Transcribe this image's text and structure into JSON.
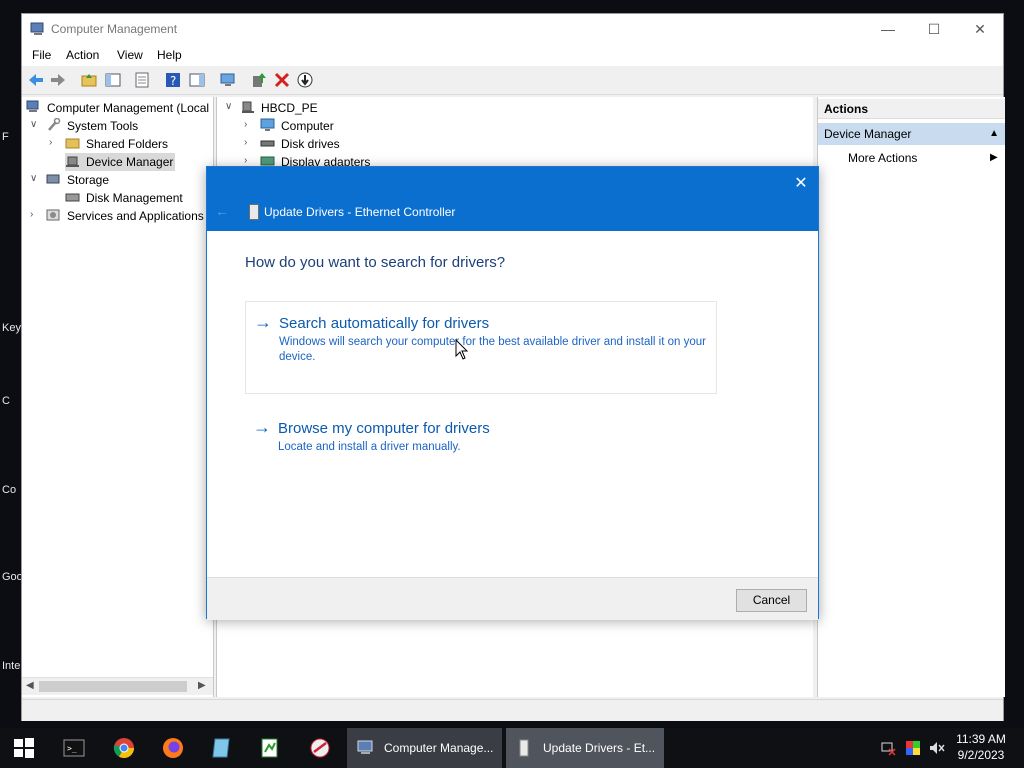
{
  "desktop": {
    "fragments": [
      "F",
      "Key",
      "C",
      "Co",
      "Goo",
      "Inte"
    ]
  },
  "window": {
    "title": "Computer Management",
    "controls": {
      "minimize": "—",
      "maximize": "☐",
      "close": "✕"
    },
    "menu": [
      "File",
      "Action",
      "View",
      "Help"
    ]
  },
  "tree": {
    "root": "Computer Management (Local",
    "system_tools": "System Tools",
    "shared_folders": "Shared Folders",
    "device_manager": "Device Manager",
    "storage": "Storage",
    "disk_management": "Disk Management",
    "services": "Services and Applications"
  },
  "devices": {
    "root": "HBCD_PE",
    "items": [
      "Computer",
      "Disk drives",
      "Display adapters"
    ]
  },
  "actions": {
    "header": "Actions",
    "section": "Device Manager",
    "more": "More Actions"
  },
  "dialog": {
    "title": "Update Drivers - Ethernet Controller",
    "question": "How do you want to search for drivers?",
    "option_auto": {
      "title": "Search automatically for drivers",
      "desc": "Windows will search your computer for the best available driver and install it on your device."
    },
    "option_browse": {
      "title": "Browse my computer for drivers",
      "desc": "Locate and install a driver manually."
    },
    "cancel": "Cancel"
  },
  "taskbar": {
    "tasks": [
      "Computer Manage...",
      "Update Drivers - Et..."
    ],
    "time": "11:39 AM",
    "date": "9/2/2023"
  },
  "colors": {
    "dialog_header": "#0b6fd0",
    "link": "#0b5aaf",
    "selection": "#c9dcef"
  }
}
